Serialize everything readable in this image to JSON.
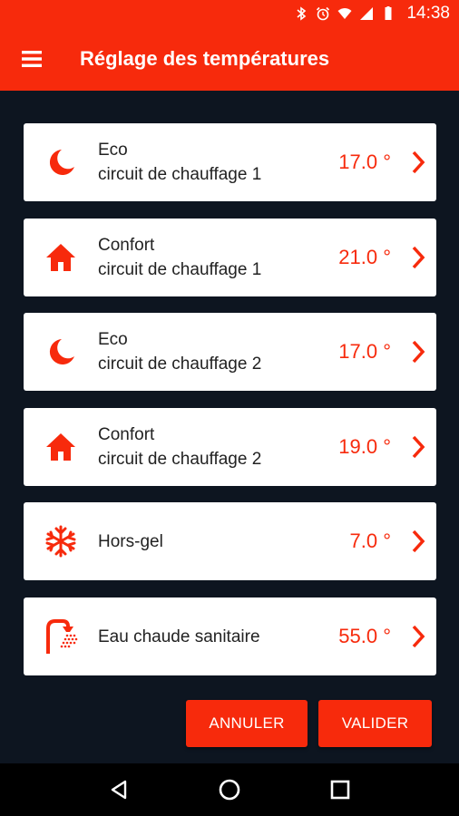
{
  "status_bar": {
    "time": "14:38",
    "icons": [
      "bluetooth-icon",
      "alarm-icon",
      "wifi-icon",
      "signal-icon",
      "battery-icon"
    ]
  },
  "app_bar": {
    "menu_icon": "hamburger-menu-icon",
    "title": "Réglage des températures"
  },
  "settings": [
    {
      "icon": "moon-icon",
      "line1": "Eco",
      "line2": "circuit de chauffage 1",
      "value": "17.0 °"
    },
    {
      "icon": "home-icon",
      "line1": "Confort",
      "line2": "circuit de chauffage 1",
      "value": "21.0 °"
    },
    {
      "icon": "moon-icon",
      "line1": "Eco",
      "line2": "circuit de chauffage 2",
      "value": "17.0 °"
    },
    {
      "icon": "home-icon",
      "line1": "Confort",
      "line2": "circuit de chauffage 2",
      "value": "19.0 °"
    },
    {
      "icon": "snowflake-icon",
      "line1": "Hors-gel",
      "line2": "",
      "value": "7.0 °"
    },
    {
      "icon": "shower-icon",
      "line1": "Eau chaude sanitaire",
      "line2": "",
      "value": "55.0 °"
    }
  ],
  "actions": {
    "cancel_label": "ANNULER",
    "validate_label": "VALIDER"
  },
  "nav_bar": {
    "icons": [
      "back-icon",
      "home-circle-icon",
      "recents-icon"
    ]
  },
  "colors": {
    "accent": "#f72a0c",
    "background": "#0d1520",
    "card": "#ffffff"
  }
}
